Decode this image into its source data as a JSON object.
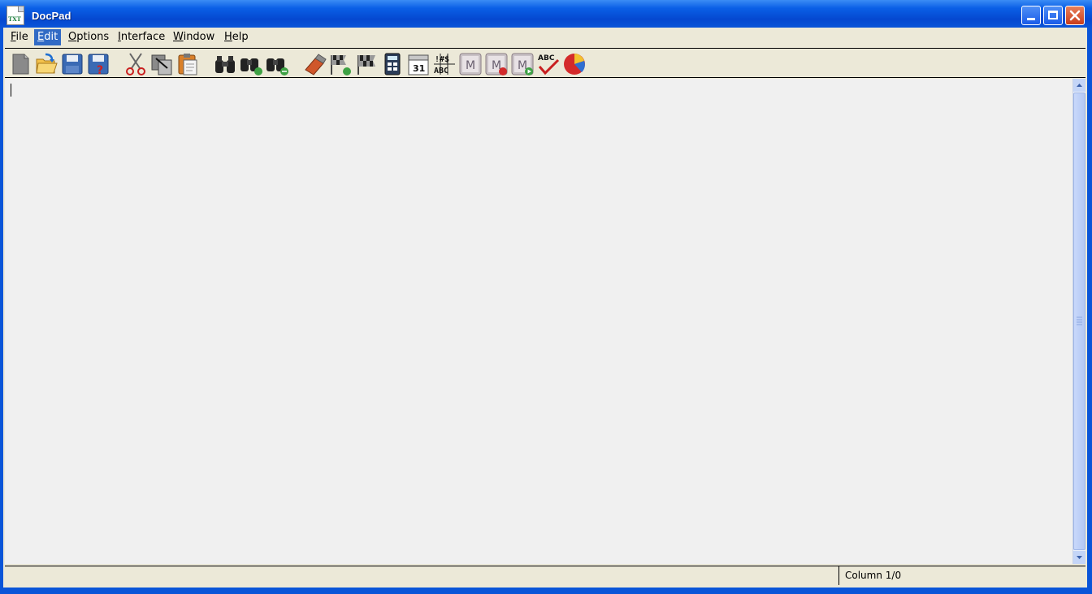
{
  "window": {
    "title": "DocPad",
    "icon": "txt-document-icon",
    "icon_text": "TXT",
    "buttons": [
      "minimize-icon",
      "maximize-icon",
      "close-icon"
    ]
  },
  "menu": {
    "items": [
      {
        "label": "File",
        "mnemonic": "F",
        "rest": "ile"
      },
      {
        "label": "Edit",
        "mnemonic": "E",
        "rest": "dit",
        "active": true
      },
      {
        "label": "Options",
        "mnemonic": "O",
        "rest": "ptions"
      },
      {
        "label": "Interface",
        "mnemonic": "I",
        "rest": "nterface"
      },
      {
        "label": "Window",
        "mnemonic": "W",
        "rest": "indow"
      },
      {
        "label": "Help",
        "mnemonic": "H",
        "rest": "elp"
      }
    ]
  },
  "toolbar": {
    "buttons": [
      "new-document-icon",
      "open-folder-icon",
      "save-icon",
      "save-as-icon",
      "cut-icon",
      "copy-icon",
      "paste-icon",
      "find-icon",
      "find-next-icon",
      "replace-icon",
      "eraser-icon",
      "goto-flag-icon",
      "flag-icon",
      "calculator-icon",
      "calendar-icon",
      "character-map-icon",
      "macro-icon",
      "macro-record-icon",
      "macro-play-icon",
      "spellcheck-icon",
      "statistics-pie-icon"
    ],
    "calendar_day": "31",
    "charmap_top": "!#$",
    "charmap_bottom": "ABC",
    "macro_letter": "M",
    "spell_letters": "ABC"
  },
  "editor": {
    "content": ""
  },
  "status": {
    "column": "Column 1/0"
  },
  "colors": {
    "title_bar": "#0a55d8",
    "menu_active": "#316ac5",
    "editor_bg": "#f0f0f0",
    "chrome": "#ece9d8"
  }
}
